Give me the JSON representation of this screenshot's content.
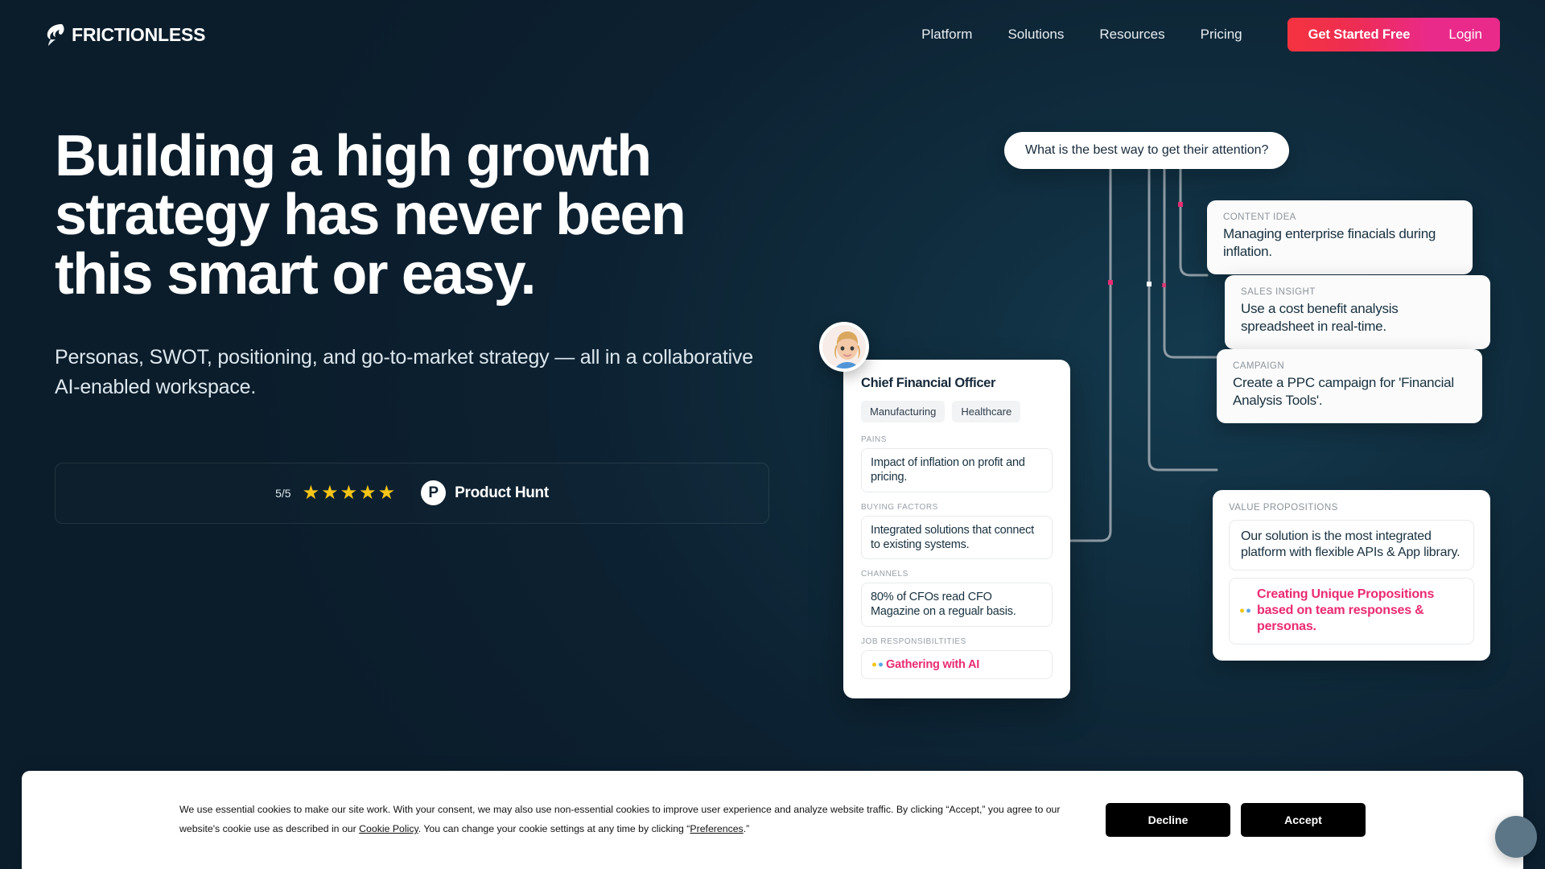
{
  "brand": {
    "name": "FRICTIONLESS",
    "logo_icon": "frictionless-swoosh-icon"
  },
  "nav": {
    "links": [
      {
        "label": "Platform"
      },
      {
        "label": "Solutions"
      },
      {
        "label": "Resources"
      },
      {
        "label": "Pricing"
      }
    ],
    "cta_primary": "Get Started Free",
    "cta_secondary": "Login",
    "colors": {
      "cta_gradient_from": "#f5333f",
      "cta_gradient_to": "#ea2a8a",
      "login_bg": "#ea2a8a"
    }
  },
  "hero": {
    "headline": "Building a high growth strategy has never been this smart or easy.",
    "subhead": "Personas, SWOT, positioning, and go-to-market strategy — all in a collaborative AI-enabled workspace.",
    "rating": {
      "score": "5/5",
      "stars": "★★★★★",
      "star_count": 5,
      "star_color": "#f5c518",
      "source_initial": "P",
      "source_name": "Product Hunt"
    }
  },
  "diagram": {
    "question_bubble": "What is the best way to get their attention?",
    "cards": [
      {
        "label": "CONTENT IDEA",
        "text": "Managing enterprise finacials during inflation."
      },
      {
        "label": "SALES INSIGHT",
        "text": "Use a cost benefit analysis spreadsheet in real-time."
      },
      {
        "label": "CAMPAIGN",
        "text": "Create a PPC campaign for 'Financial Analysis Tools'."
      }
    ],
    "value_propositions": {
      "label": "VALUE PROPOSITIONS",
      "items": [
        {
          "text": "Our solution is the most integrated platform with flexible APIs & App library.",
          "accent": false
        },
        {
          "text": "Creating Unique Propositions based on team responses & personas.",
          "accent": true
        }
      ]
    },
    "accent_color": "#ea2a72",
    "connector_color": "#8e9ba4"
  },
  "persona": {
    "avatar_icon": "woman-avatar",
    "title": "Chief Financial Officer",
    "chips": [
      "Manufacturing",
      "Healthcare"
    ],
    "fields": [
      {
        "label": "PAINS",
        "text": "Impact of inflation on profit and pricing.",
        "accent": false
      },
      {
        "label": "BUYING FACTORS",
        "text": "Integrated solutions that connect to existing systems.",
        "accent": false
      },
      {
        "label": "CHANNELS",
        "text": "80% of CFOs read CFO Magazine on a regualr basis.",
        "accent": false
      },
      {
        "label": "JOB RESPONSIBILTITIES",
        "text": "Gathering with AI",
        "accent": true
      }
    ]
  },
  "cookie_banner": {
    "text_part1": "We use essential cookies to make our site work. With your consent, we may also use non-essential cookies to improve user experience and analyze website traffic. By clicking “Accept,” you agree to our website's cookie use as described in our ",
    "link1": "Cookie Policy",
    "text_part2": ". You can change your cookie settings at any time by clicking “",
    "link2": "Preferences",
    "text_part3": ".”",
    "decline_label": "Decline",
    "accept_label": "Accept"
  },
  "chat_widget": {
    "icon": "chat-bubble-icon"
  }
}
